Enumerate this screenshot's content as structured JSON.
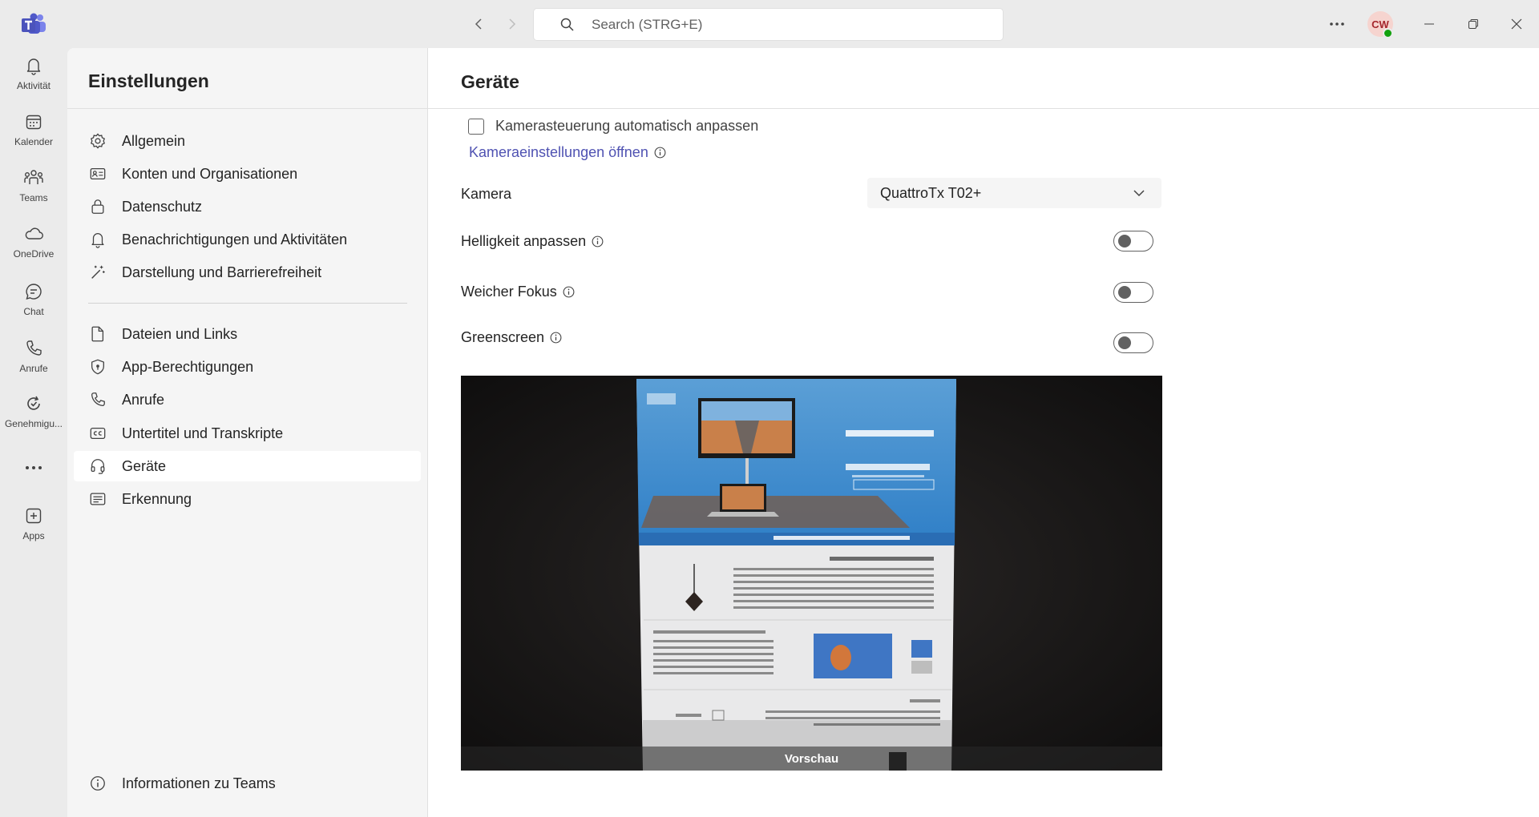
{
  "titlebar": {
    "search_placeholder": "Search (STRG+E)",
    "avatar_initials": "CW"
  },
  "rail": {
    "items": [
      {
        "label": "Aktivität",
        "icon": "bell-icon"
      },
      {
        "label": "Kalender",
        "icon": "calendar-icon"
      },
      {
        "label": "Teams",
        "icon": "teams-icon"
      },
      {
        "label": "OneDrive",
        "icon": "cloud-icon"
      },
      {
        "label": "Chat",
        "icon": "chat-icon"
      },
      {
        "label": "Anrufe",
        "icon": "phone-icon"
      },
      {
        "label": "Genehmigu...",
        "icon": "approvals-icon"
      },
      {
        "label": "Apps",
        "icon": "add-apps-icon"
      }
    ]
  },
  "settings_nav": {
    "title": "Einstellungen",
    "items": [
      {
        "label": "Allgemein",
        "icon": "gear-icon"
      },
      {
        "label": "Konten und Organisationen",
        "icon": "id-card-icon"
      },
      {
        "label": "Datenschutz",
        "icon": "lock-icon"
      },
      {
        "label": "Benachrichtigungen und Aktivitäten",
        "icon": "bell-icon"
      },
      {
        "label": "Darstellung und Barrierefreiheit",
        "icon": "magic-wand-icon"
      },
      {
        "label": "Dateien und Links",
        "icon": "file-icon"
      },
      {
        "label": "App-Berechtigungen",
        "icon": "shield-icon"
      },
      {
        "label": "Anrufe",
        "icon": "phone-icon"
      },
      {
        "label": "Untertitel und Transkripte",
        "icon": "closed-captions-icon"
      },
      {
        "label": "Geräte",
        "icon": "headset-icon",
        "active": true
      },
      {
        "label": "Erkennung",
        "icon": "recognition-icon"
      }
    ],
    "footer_label": "Informationen zu Teams"
  },
  "main": {
    "title": "Geräte",
    "camera_control_label": "Kamerasteuerung automatisch anpassen",
    "camera_control_checked": false,
    "camera_settings_link": "Kameraeinstellungen öffnen",
    "camera_label": "Kamera",
    "camera_value": "QuattroTx T02+",
    "brightness_label": "Helligkeit anpassen",
    "brightness_on": false,
    "soft_focus_label": "Weicher Fokus",
    "soft_focus_on": false,
    "greenscreen_label": "Greenscreen",
    "greenscreen_on": false,
    "preview_label": "Vorschau"
  },
  "colors": {
    "accent": "#4f52b2",
    "rail_bg": "#ebebeb",
    "nav_bg": "#f5f5f5",
    "presence": "#13a10e"
  }
}
